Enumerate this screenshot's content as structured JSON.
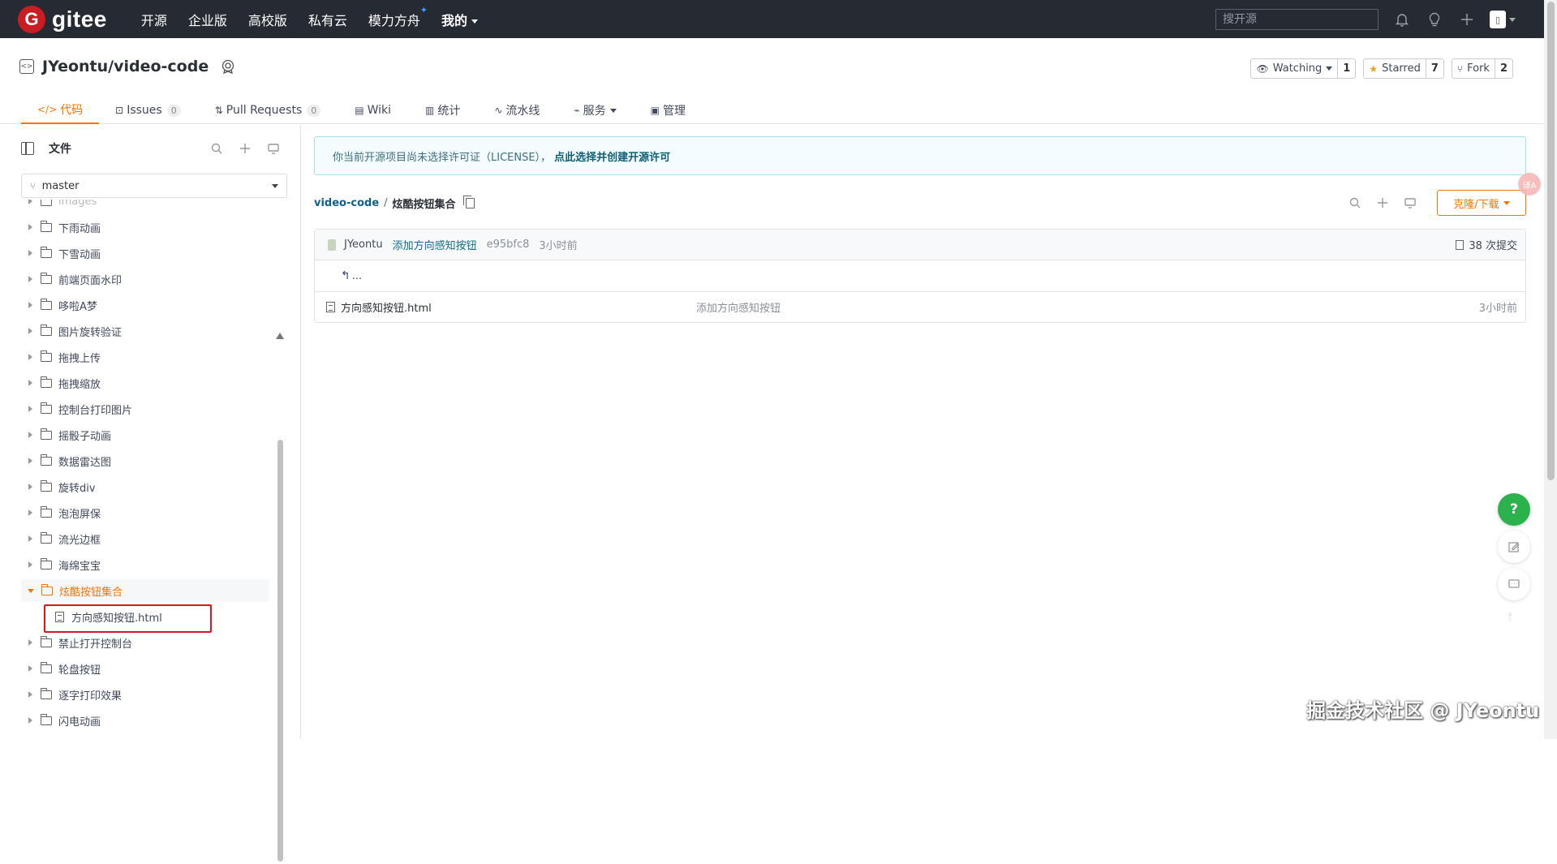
{
  "nav": {
    "logo_letter": "G",
    "logo_text": "gitee",
    "links": [
      {
        "label": "开源"
      },
      {
        "label": "企业版"
      },
      {
        "label": "高校版"
      },
      {
        "label": "私有云"
      },
      {
        "label": "模力方舟"
      },
      {
        "label": "我的"
      }
    ],
    "search_placeholder": "搜开源",
    "icons": [
      "bell-icon",
      "lightbulb-icon",
      "plus-icon",
      "avatar"
    ]
  },
  "repo": {
    "name": "JYeontu/video-code",
    "actions": [
      {
        "label": "Watching",
        "count": "1"
      },
      {
        "label": "Starred",
        "count": "7"
      },
      {
        "label": "Fork",
        "count": "2"
      }
    ],
    "tabs": [
      {
        "label": "代码",
        "icon": "</>"
      },
      {
        "label": "Issues",
        "count": "0"
      },
      {
        "label": "Pull Requests",
        "count": "0"
      },
      {
        "label": "Wiki"
      },
      {
        "label": "统计"
      },
      {
        "label": "流水线"
      },
      {
        "label": "服务"
      },
      {
        "label": "管理"
      }
    ]
  },
  "sidebar": {
    "title": "文件",
    "branch": "master",
    "tree": [
      {
        "label": "images",
        "type": "folder",
        "partial": true
      },
      {
        "label": "下雨动画",
        "type": "folder"
      },
      {
        "label": "下雪动画",
        "type": "folder"
      },
      {
        "label": "前端页面水印",
        "type": "folder"
      },
      {
        "label": "哆啦A梦",
        "type": "folder"
      },
      {
        "label": "图片旋转验证",
        "type": "folder"
      },
      {
        "label": "拖拽上传",
        "type": "folder"
      },
      {
        "label": "拖拽缩放",
        "type": "folder"
      },
      {
        "label": "控制台打印图片",
        "type": "folder"
      },
      {
        "label": "摇骰子动画",
        "type": "folder"
      },
      {
        "label": "数据雷达图",
        "type": "folder"
      },
      {
        "label": "旋转div",
        "type": "folder"
      },
      {
        "label": "泡泡屏保",
        "type": "folder"
      },
      {
        "label": "流光边框",
        "type": "folder"
      },
      {
        "label": "海绵宝宝",
        "type": "folder"
      },
      {
        "label": "炫酷按钮集合",
        "type": "folder",
        "active": true
      },
      {
        "label": "方向感知按钮.html",
        "type": "file"
      },
      {
        "label": "禁止打开控制台",
        "type": "folder"
      },
      {
        "label": "轮盘按钮",
        "type": "folder"
      },
      {
        "label": "逐字打印效果",
        "type": "folder"
      },
      {
        "label": "闪电动画",
        "type": "folder"
      }
    ]
  },
  "main": {
    "license_text": "你当前开源项目尚未选择许可证（LICENSE），",
    "license_link": "点此选择并创建开源许可",
    "breadcrumb_root": "video-code",
    "breadcrumb_sep": "/",
    "breadcrumb_current": "炫酷按钮集合",
    "clone_label": "克隆/下载",
    "commit": {
      "author": "JYeontu",
      "message": "添加方向感知按钮",
      "sha": "e95bfc8",
      "time": "3小时前",
      "count_label": "38 次提交"
    },
    "back_label": "...",
    "files": [
      {
        "name": "方向感知按钮.html",
        "message": "添加方向感知按钮",
        "time": "3小时前"
      }
    ]
  },
  "floating": {
    "help_label": "?",
    "translate_label": "译A"
  },
  "watermark": "掘金技术社区 @ JYeontu",
  "colors": {
    "accent": "#fe7300",
    "nav_bg": "#262a32",
    "brand_red": "#c71d23",
    "link": "#0f5f8c",
    "highlight_box": "#e0141b"
  }
}
